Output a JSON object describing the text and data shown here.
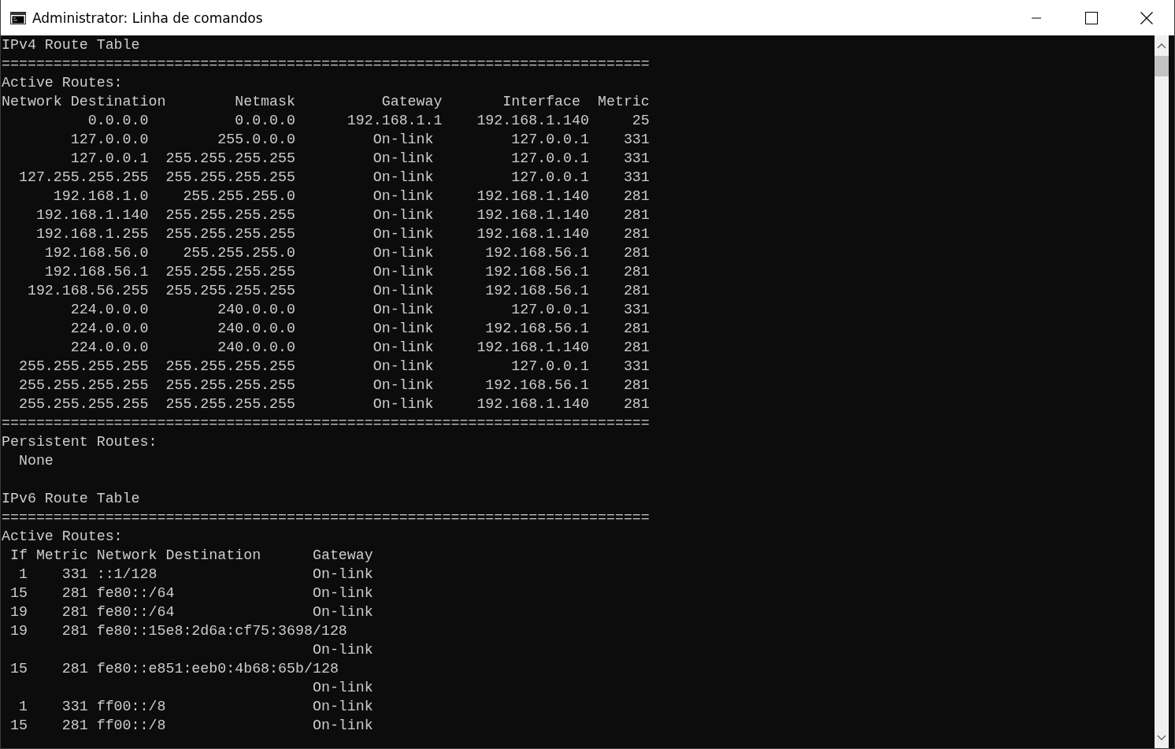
{
  "window": {
    "title": "Administrator: Linha de comandos"
  },
  "console": {
    "lines": [
      {
        "kind": "text",
        "text": "IPv4 Route Table"
      },
      {
        "kind": "text",
        "text": "==========================================================================="
      },
      {
        "kind": "text",
        "text": "Active Routes:"
      },
      {
        "kind": "text",
        "text": "Network Destination        Netmask          Gateway       Interface  Metric"
      },
      {
        "kind": "text",
        "text": "          0.0.0.0          0.0.0.0      192.168.1.1    192.168.1.140     25"
      },
      {
        "kind": "text",
        "text": "        127.0.0.0        255.0.0.0         On-link         127.0.0.1    331"
      },
      {
        "kind": "text",
        "text": "        127.0.0.1  255.255.255.255         On-link         127.0.0.1    331"
      },
      {
        "kind": "text",
        "text": "  127.255.255.255  255.255.255.255         On-link         127.0.0.1    331"
      },
      {
        "kind": "text",
        "text": "      192.168.1.0    255.255.255.0         On-link     192.168.1.140    281"
      },
      {
        "kind": "text",
        "text": "    192.168.1.140  255.255.255.255         On-link     192.168.1.140    281"
      },
      {
        "kind": "text",
        "text": "    192.168.1.255  255.255.255.255         On-link     192.168.1.140    281"
      },
      {
        "kind": "text",
        "text": "     192.168.56.0    255.255.255.0         On-link      192.168.56.1    281"
      },
      {
        "kind": "text",
        "text": "     192.168.56.1  255.255.255.255         On-link      192.168.56.1    281"
      },
      {
        "kind": "text",
        "text": "   192.168.56.255  255.255.255.255         On-link      192.168.56.1    281"
      },
      {
        "kind": "text",
        "text": "        224.0.0.0        240.0.0.0         On-link         127.0.0.1    331"
      },
      {
        "kind": "text",
        "text": "        224.0.0.0        240.0.0.0         On-link      192.168.56.1    281"
      },
      {
        "kind": "text",
        "text": "        224.0.0.0        240.0.0.0         On-link     192.168.1.140    281"
      },
      {
        "kind": "text",
        "text": "  255.255.255.255  255.255.255.255         On-link         127.0.0.1    331"
      },
      {
        "kind": "text",
        "text": "  255.255.255.255  255.255.255.255         On-link      192.168.56.1    281"
      },
      {
        "kind": "text",
        "text": "  255.255.255.255  255.255.255.255         On-link     192.168.1.140    281"
      },
      {
        "kind": "text",
        "text": "==========================================================================="
      },
      {
        "kind": "text",
        "text": "Persistent Routes:"
      },
      {
        "kind": "text",
        "text": "  None"
      },
      {
        "kind": "blank"
      },
      {
        "kind": "text",
        "text": "IPv6 Route Table"
      },
      {
        "kind": "text",
        "text": "==========================================================================="
      },
      {
        "kind": "text",
        "text": "Active Routes:"
      },
      {
        "kind": "text",
        "text": " If Metric Network Destination      Gateway"
      },
      {
        "kind": "text",
        "text": "  1    331 ::1/128                  On-link"
      },
      {
        "kind": "text",
        "text": " 15    281 fe80::/64                On-link"
      },
      {
        "kind": "text",
        "text": " 19    281 fe80::/64                On-link"
      },
      {
        "kind": "text",
        "text": " 19    281 fe80::15e8:2d6a:cf75:3698/128"
      },
      {
        "kind": "text",
        "text": "                                    On-link"
      },
      {
        "kind": "text",
        "text": " 15    281 fe80::e851:eeb0:4b68:65b/128"
      },
      {
        "kind": "text",
        "text": "                                    On-link"
      },
      {
        "kind": "text",
        "text": "  1    331 ff00::/8                 On-link"
      },
      {
        "kind": "text",
        "text": " 15    281 ff00::/8                 On-link"
      }
    ]
  }
}
